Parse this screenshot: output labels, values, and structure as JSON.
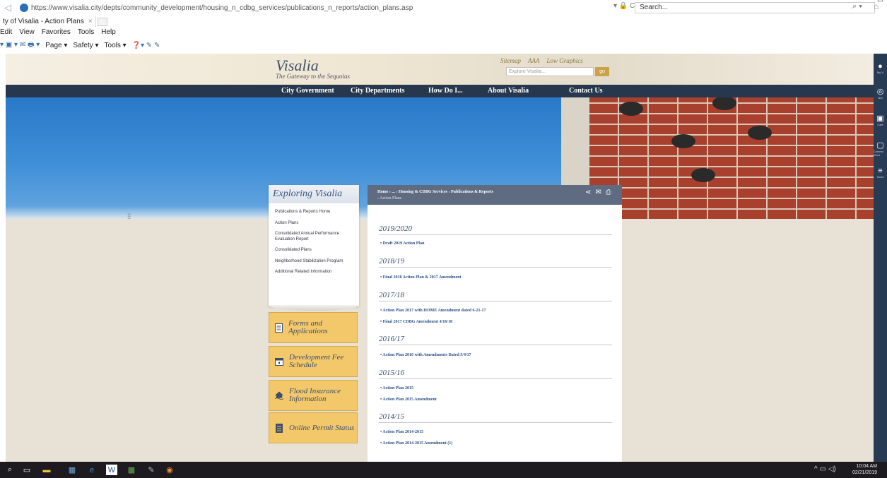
{
  "browser": {
    "url": "https://www.visalia.city/depts/community_development/housing_n_cdbg_services/publications_n_reports/action_plans.asp",
    "search_placeholder": "Search...",
    "tab_title": "ty of Visalia - Action Plans",
    "tab_close": "×",
    "menu": [
      "Edit",
      "View",
      "Favorites",
      "Tools",
      "Help"
    ],
    "commands": [
      "Page ▾",
      "Safety ▾",
      "Tools ▾"
    ],
    "url_tools": "▾ 🔒 C",
    "search_go": "⌕ ▾",
    "window_min": "—",
    "window_close": "☐"
  },
  "site": {
    "logo": "Visalia",
    "tagline": "The Gateway to the Sequoias",
    "util_links": [
      "Sitemap",
      "AAA",
      "Low Graphics"
    ],
    "search_placeholder": "Explore Visalia...",
    "search_go": "go",
    "nav": [
      "City Government",
      "City Departments",
      "How Do I...",
      "About Visalia",
      "Contact Us"
    ]
  },
  "sidebar": {
    "heading": "Exploring Visalia",
    "links": [
      "Publications & Reports Home",
      "Action Plans",
      "Consolidated Annual Performance Evaluation Report",
      "Consolidated Plans",
      "Neighborhood Stabilization Program",
      "Additional Related Information"
    ],
    "promos": [
      {
        "label": "Forms and Applications",
        "icon": "document-icon"
      },
      {
        "label": "Development Fee Schedule",
        "icon": "calendar-icon"
      },
      {
        "label": "Flood Insurance Information",
        "icon": "flood-house-icon"
      },
      {
        "label": "Online Permit Status",
        "icon": "permit-doc-icon"
      }
    ]
  },
  "content": {
    "breadcrumb": "Home  ›  ...  ›  Housing & CDBG Services  ›  Publications & Reports",
    "breadcrumb_current": "›  Action Plans",
    "sections": [
      {
        "year": "2019/2020",
        "links": [
          "Draft 2019 Action Plan"
        ]
      },
      {
        "year": "2018/19",
        "links": [
          "Final 2018 Action Plan & 2017 Amendment"
        ]
      },
      {
        "year": "2017/18",
        "links": [
          "Action Plan 2017 with HOME Amendment dated 6-21-17",
          "Final 2017 CDBG Amendment 4/16/18"
        ]
      },
      {
        "year": "2016/17",
        "links": [
          "Action Plan 2016 with Amendments Dated 5/4/17"
        ]
      },
      {
        "year": "2015/16",
        "links": [
          "Action Plan 2015",
          "Action Plan 2015 Amendment"
        ]
      },
      {
        "year": "2014/15",
        "links": [
          "Action Plan 2014-2015",
          "Action Plan 2014-2015 Amendment (1)"
        ]
      }
    ]
  },
  "right_rail": {
    "items": [
      {
        "label": "My V",
        "icon": "user-icon"
      },
      {
        "label": "Not",
        "icon": "bell-icon"
      },
      {
        "label": "Cale",
        "icon": "calendar-icon"
      },
      {
        "label": "Commu Servi",
        "icon": "doc-icon"
      },
      {
        "label": "Socia",
        "icon": "social-icon"
      }
    ]
  },
  "taskbar": {
    "time": "10:04 AM",
    "date": "02/21/2019"
  }
}
